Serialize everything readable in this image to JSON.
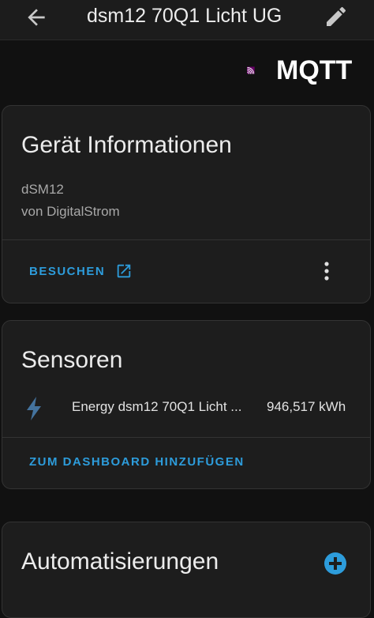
{
  "header": {
    "title": "dsm12 70Q1 Licht UG"
  },
  "integration": {
    "logo_text": "MQTT",
    "logo_color": "#660066"
  },
  "device_info": {
    "title": "Gerät Informationen",
    "model": "dSM12",
    "manufacturer": "von DigitalStrom",
    "visit_label": "BESUCHEN"
  },
  "sensors": {
    "title": "Sensoren",
    "items": [
      {
        "name": "Energy dsm12 70Q1 Licht ...",
        "value": "946,517 kWh",
        "icon": "flash-icon"
      }
    ],
    "add_label": "ZUM DASHBOARD HINZUFÜGEN"
  },
  "automations": {
    "title": "Automatisierungen"
  },
  "colors": {
    "accent": "#2d9cdb",
    "background": "#111111",
    "card": "#1d1d1d"
  }
}
